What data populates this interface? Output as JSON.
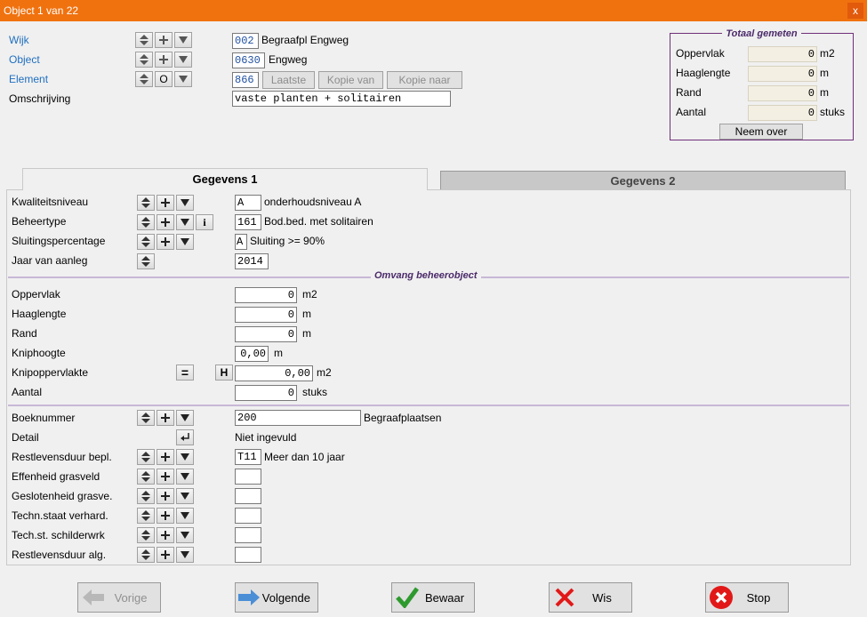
{
  "window": {
    "title": "Object 1 van 22",
    "close_label": "x"
  },
  "header": {
    "wijk": {
      "label": "Wijk",
      "code": "002",
      "value": "Begraafpl Engweg"
    },
    "object": {
      "label": "Object",
      "code": "0630",
      "value": "Engweg"
    },
    "element": {
      "label": "Element",
      "code": "866",
      "btn_o": "O",
      "laatste": "Laatste",
      "kopie_van": "Kopie van",
      "kopie_naar": "Kopie naar"
    },
    "omschrijving": {
      "label": "Omschrijving",
      "value": "vaste planten + solitairen"
    }
  },
  "totaal": {
    "legend": "Totaal gemeten",
    "rows": [
      {
        "label": "Oppervlak",
        "value": "0",
        "unit": "m2"
      },
      {
        "label": "Haaglengte",
        "value": "0",
        "unit": "m"
      },
      {
        "label": "Rand",
        "value": "0",
        "unit": "m"
      },
      {
        "label": "Aantal",
        "value": "0",
        "unit": "stuks"
      }
    ],
    "button": "Neem over"
  },
  "tabs": {
    "tab1": "Gegevens 1",
    "tab2": "Gegevens 2"
  },
  "section1": {
    "kwaliteit": {
      "label": "Kwaliteitsniveau",
      "code": "A",
      "value": "onderhoudsniveau A"
    },
    "beheertype": {
      "label": "Beheertype",
      "code": "161",
      "value": "Bod.bed. met solitairen",
      "info": "i"
    },
    "sluiting": {
      "label": "Sluitingspercentage",
      "code": "A",
      "value": "Sluiting >= 90%"
    },
    "jaar": {
      "label": "Jaar van aanleg",
      "value": "2014"
    }
  },
  "omvang": {
    "legend": "Omvang beheerobject",
    "oppervlak": {
      "label": "Oppervlak",
      "value": "0",
      "unit": "m2"
    },
    "haaglengte": {
      "label": "Haaglengte",
      "value": "0",
      "unit": "m"
    },
    "rand": {
      "label": "Rand",
      "value": "0",
      "unit": "m"
    },
    "kniphoogte": {
      "label": "Kniphoogte",
      "value": "0,00",
      "unit": "m"
    },
    "knipopp": {
      "label": "Knipoppervlakte",
      "value": "0,00",
      "unit": "m2",
      "btn_eq": "=",
      "btn_h": "H"
    },
    "aantal": {
      "label": "Aantal",
      "value": "0",
      "unit": "stuks"
    }
  },
  "section3": {
    "boeknummer": {
      "label": "Boeknummer",
      "value": "200",
      "desc": "Begraafplaatsen"
    },
    "detail": {
      "label": "Detail",
      "desc": "Niet ingevuld"
    },
    "restlevensduur_bepl": {
      "label": "Restlevensduur bepl.",
      "code": "T11",
      "desc": "Meer dan 10 jaar"
    },
    "effenheid": {
      "label": "Effenheid grasveld",
      "code": ""
    },
    "geslotenheid": {
      "label": "Geslotenheid grasve.",
      "code": ""
    },
    "techn_staat": {
      "label": "Techn.staat verhard.",
      "code": ""
    },
    "tech_schilder": {
      "label": "Tech.st. schilderwrk",
      "code": ""
    },
    "restlevensduur_alg": {
      "label": "Restlevensduur alg.",
      "code": ""
    }
  },
  "footer": {
    "vorige": "Vorige",
    "volgende": "Volgende",
    "bewaar": "Bewaar",
    "wis": "Wis",
    "stop": "Stop"
  },
  "colors": {
    "titlebar": "#f0720f",
    "link": "#1f6fc0",
    "accent_purple": "#4b2a6a"
  }
}
